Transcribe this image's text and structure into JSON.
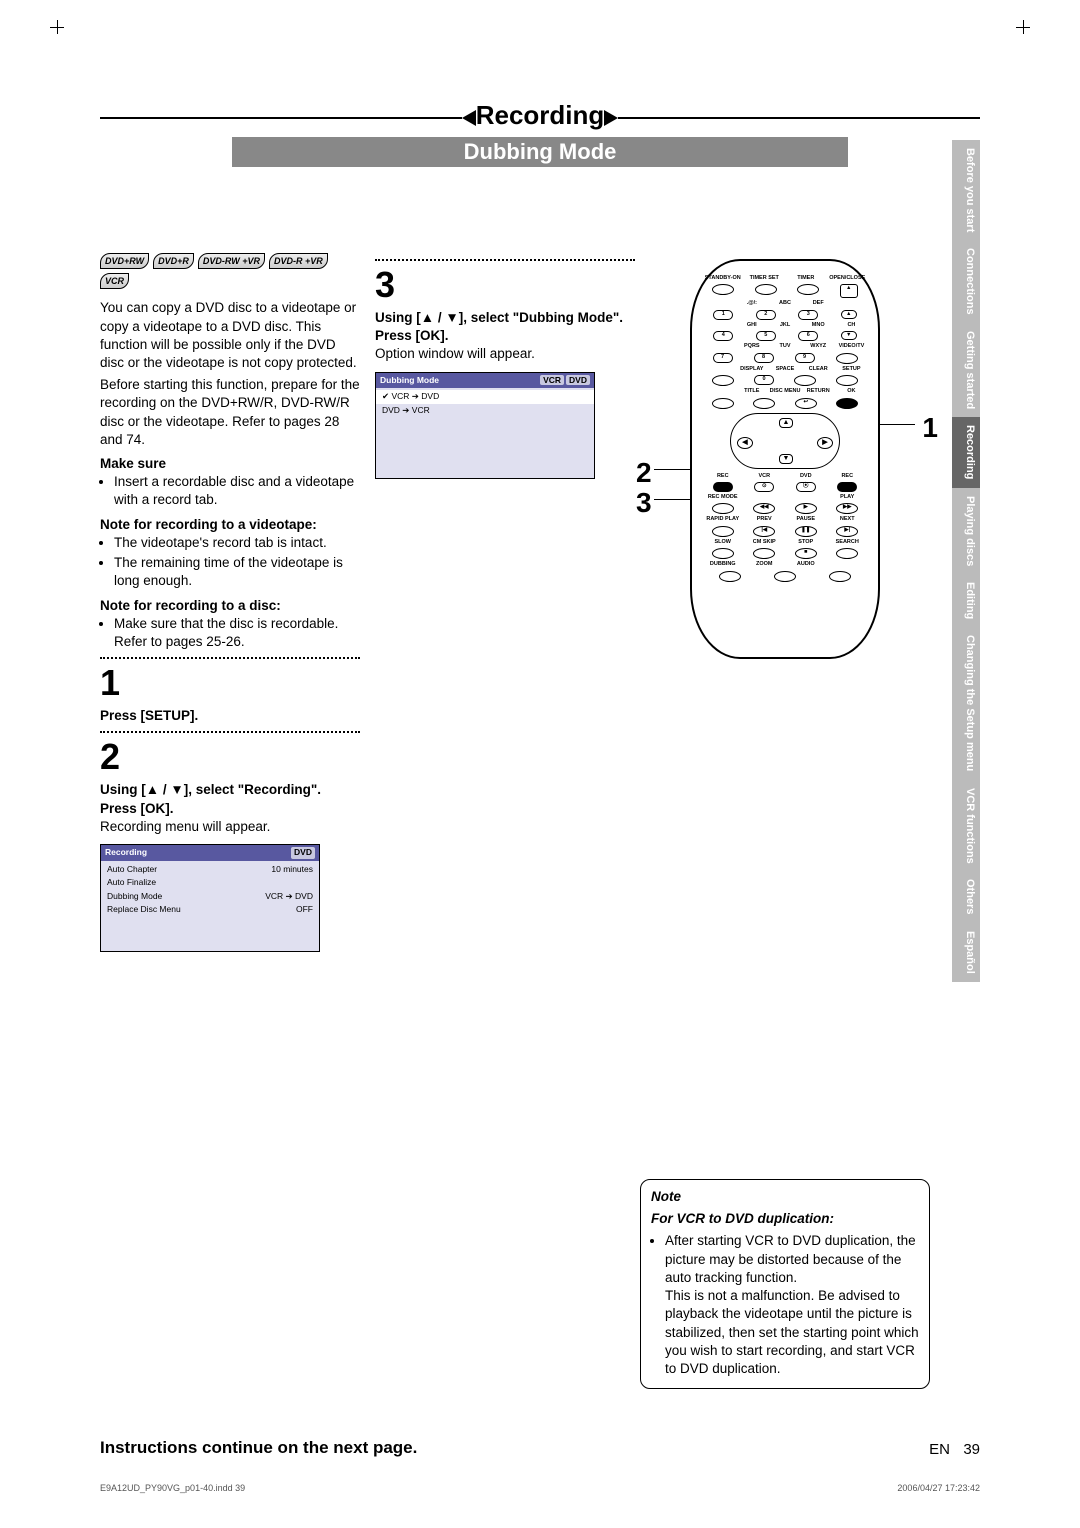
{
  "chapter": "Recording",
  "section": "Dubbing Mode",
  "disc_badges": [
    "DVD+RW",
    "DVD+R",
    "DVD-RW +VR",
    "DVD-R +VR",
    "VCR"
  ],
  "intro_p1": "You can copy a DVD disc to a videotape or copy a videotape to a DVD disc. This function will be possible only if the DVD disc or the videotape is not copy protected.",
  "intro_p2": "Before starting this function, prepare for the recording on the DVD+RW/R, DVD-RW/R disc or the videotape. Refer to pages 28 and 74.",
  "make_sure_h": "Make sure",
  "make_sure": [
    "Insert a recordable disc and a videotape with a record tab."
  ],
  "note_vt_h": "Note for recording to a videotape:",
  "note_vt": [
    "The videotape's record tab is intact.",
    "The remaining time of the videotape is long enough."
  ],
  "note_disc_h": "Note for recording to a disc:",
  "note_disc": [
    "Make sure that the disc is recordable. Refer to pages 25-26."
  ],
  "step1_n": "1",
  "step1_t": "Press [SETUP].",
  "step2_n": "2",
  "step2_t": "Using [▲ / ▼], select \"Recording\". Press [OK].",
  "step2_sub": "Recording menu will appear.",
  "step3_n": "3",
  "step3_t": "Using [▲ / ▼], select \"Dubbing Mode\". Press [OK].",
  "step3_sub": "Option window will appear.",
  "osd_rec": {
    "title": "Recording",
    "tag": "DVD",
    "rows": [
      {
        "k": "Auto Chapter",
        "v": "10 minutes"
      },
      {
        "k": "Auto Finalize",
        "v": ""
      },
      {
        "k": "Dubbing Mode",
        "v": "VCR ➔ DVD"
      },
      {
        "k": "Replace Disc Menu",
        "v": "OFF"
      }
    ]
  },
  "osd_dub": {
    "title": "Dubbing Mode",
    "tags": [
      "VCR",
      "DVD"
    ],
    "rows": [
      {
        "k": "VCR ➔ DVD",
        "sel": true
      },
      {
        "k": "DVD ➔ VCR",
        "sel": false
      }
    ]
  },
  "note": {
    "title": "Note",
    "sub": "For VCR to DVD duplication:",
    "body": "After starting VCR to DVD duplication, the picture may be distorted because of the auto tracking function.\nThis is not a malfunction. Be advised to playback the videotape until the picture is stabilized, then set the starting point which you wish to start recording, and start VCR to DVD duplication."
  },
  "sidebar": [
    {
      "label": "Before you start",
      "active": false
    },
    {
      "label": "Connections",
      "active": false
    },
    {
      "label": "Getting started",
      "active": false
    },
    {
      "label": "Recording",
      "active": true
    },
    {
      "label": "Playing discs",
      "active": false
    },
    {
      "label": "Editing",
      "active": false
    },
    {
      "label": "Changing the Setup menu",
      "active": false
    },
    {
      "label": "VCR functions",
      "active": false
    },
    {
      "label": "Others",
      "active": false
    },
    {
      "label": "Español",
      "active": false
    }
  ],
  "remote": {
    "r1": [
      "STANDBY-ON",
      "TIMER SET",
      "TIMER",
      "OPEN/CLOSE"
    ],
    "r2a": [
      "",
      ".@/:",
      "ABC",
      "DEF",
      ""
    ],
    "r2b": [
      "",
      "1",
      "2",
      "3",
      "▲"
    ],
    "r3a": [
      "",
      "GHI",
      "JKL",
      "MNO",
      "CH"
    ],
    "r3b": [
      "",
      "4",
      "5",
      "6",
      "▼"
    ],
    "r4a": [
      "",
      "PQRS",
      "TUV",
      "WXYZ",
      "VIDEO/TV"
    ],
    "r4b": [
      "",
      "7",
      "8",
      "9",
      ""
    ],
    "r5a": [
      "",
      "DISPLAY",
      "SPACE",
      "CLEAR",
      "SETUP"
    ],
    "r5b": [
      "",
      "",
      "0",
      "",
      ""
    ],
    "r6a": [
      "",
      "TITLE",
      "DISC MENU",
      "RETURN",
      "OK"
    ],
    "dpad": {
      "up": "▲",
      "down": "▼",
      "left": "◀",
      "right": "▶"
    },
    "r7h": [
      "REC",
      "VCR",
      "DVD",
      "REC"
    ],
    "r8a": [
      "REC MODE",
      "",
      "",
      "PLAY"
    ],
    "r9a": [
      "RAPID PLAY",
      "PREV",
      "PAUSE",
      "NEXT"
    ],
    "r10a": [
      "SLOW",
      "CM SKIP",
      "STOP",
      "SEARCH"
    ],
    "r11a": [
      "DUBBING",
      "ZOOM",
      "AUDIO",
      ""
    ]
  },
  "callouts": {
    "c1": "1",
    "c2": "2",
    "c3": "3"
  },
  "footer": {
    "continue": "Instructions continue on the next page.",
    "lang": "EN",
    "page": "39",
    "file": "E9A12UD_PY90VG_p01-40.indd   39",
    "date": "2006/04/27   17:23:42"
  }
}
